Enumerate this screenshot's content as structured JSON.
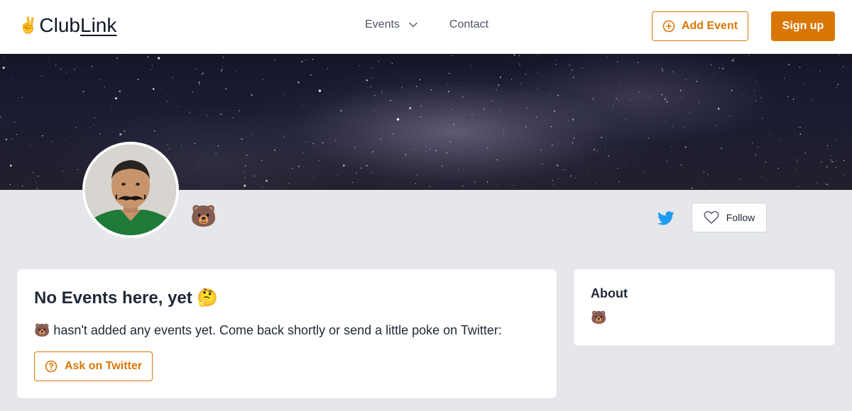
{
  "navbar": {
    "logo_emoji": "✌️",
    "logo_club": "Club",
    "logo_link": "Link",
    "events_label": "Events",
    "contact_label": "Contact",
    "add_event_label": "Add Event",
    "signup_label": "Sign up"
  },
  "profile": {
    "name": "🐻",
    "follow_label": "Follow"
  },
  "events_card": {
    "title": "No Events here, yet 🤔",
    "description": "🐻 hasn't added any events yet. Come back shortly or send a little poke on Twitter:",
    "ask_label": "Ask on Twitter"
  },
  "about_card": {
    "title": "About",
    "body": "🐻"
  },
  "colors": {
    "accent": "#d97706",
    "twitter": "#1d9bf0",
    "page_background": "#e5e7eb"
  },
  "icons": {
    "events_chevron": "chevron-down-icon",
    "add_event": "plus-circle-icon",
    "twitter": "twitter-icon",
    "follow": "heart-icon",
    "ask": "question-circle-icon"
  }
}
